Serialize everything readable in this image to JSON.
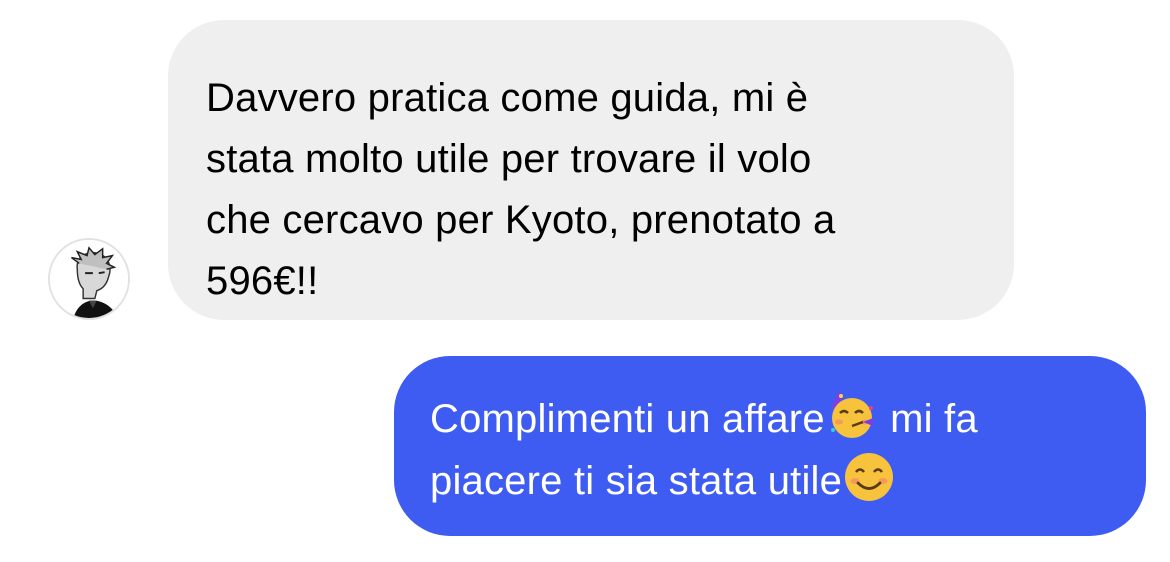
{
  "conversation": {
    "incoming": {
      "lines": [
        "Davvero pratica come guida, mi è",
        "stata molto utile per trovare il volo",
        "che cercavo per Kyoto, prenotato a",
        "596€!!"
      ]
    },
    "outgoing": {
      "line1_part1": "Complimenti un affare",
      "line1_part2": " mi fa",
      "line2": "piacere ti sia stata utile",
      "emojis": [
        "partying-face-emoji",
        "smiling-face-emoji"
      ]
    }
  },
  "colors": {
    "incoming_bubble": "#efefef",
    "outgoing_bubble": "#3e5cf2",
    "incoming_text": "#000000",
    "outgoing_text": "#ffffff"
  }
}
